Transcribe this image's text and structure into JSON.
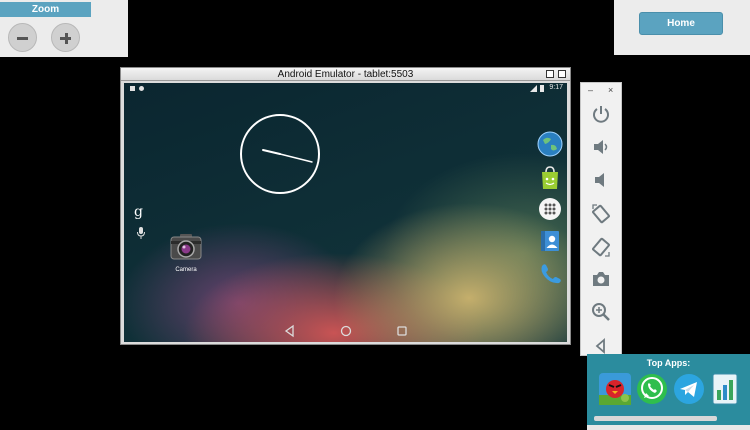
{
  "zoom": {
    "title": "Zoom",
    "out_icon": "minus-icon",
    "in_icon": "plus-icon"
  },
  "home": {
    "label": "Home"
  },
  "emulator": {
    "title": "Android Emulator - tablet:5503",
    "status_time": "9:17",
    "search_glyph": "g",
    "camera_label": "Camera",
    "favorites": [
      "browser-icon",
      "market-icon",
      "all-apps-icon",
      "contacts-icon",
      "phone-icon"
    ],
    "nav": [
      "back-icon",
      "home-icon",
      "recents-icon"
    ]
  },
  "side_panel": {
    "window_controls": [
      "–",
      "×"
    ],
    "buttons": [
      "power-icon",
      "volume-up-icon",
      "volume-down-icon",
      "rotate-left-icon",
      "rotate-right-icon",
      "camera-icon",
      "zoom-icon",
      "back-icon"
    ]
  },
  "top_apps": {
    "title": "Top Apps:",
    "apps": [
      "angry-birds-icon",
      "whatsapp-icon",
      "telegram-icon",
      "data-usage-icon"
    ]
  },
  "colors": {
    "accent": "#5ba3c0",
    "apps_panel": "#2b8c9e",
    "background": "#000000"
  }
}
